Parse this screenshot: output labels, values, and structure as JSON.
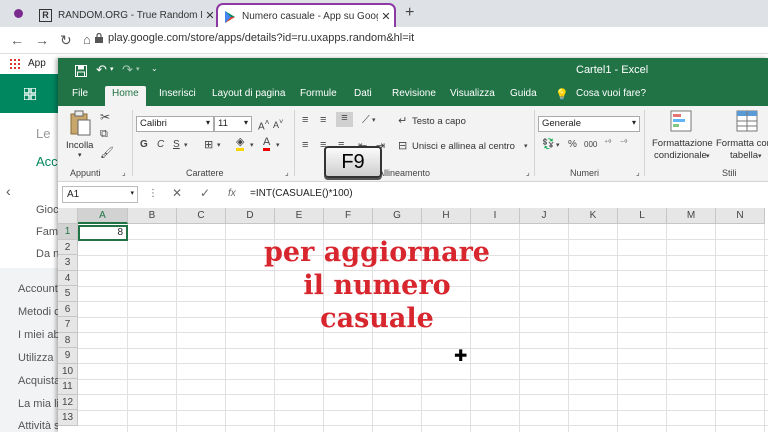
{
  "browser": {
    "tabs": [
      {
        "favicon": "R",
        "title": "RANDOM.ORG - True Random N",
        "close": "✕"
      },
      {
        "favicon": "play-icon",
        "title": "Numero casuale - App su Googl",
        "close": "✕"
      }
    ],
    "new_tab": "+",
    "url": "play.google.com/store/apps/details?id=ru.uxapps.random&hl=it",
    "bookmarks_label": "App"
  },
  "background_page": {
    "items_top": [
      "Le",
      "Acc",
      "Gioc",
      "Fam",
      "Da n"
    ],
    "items_bottom": [
      "Account",
      "Metodi c",
      "I miei ab",
      "Utilizza",
      "Acquista",
      "La mia li",
      "Attività s"
    ]
  },
  "excel": {
    "workbook_title": "Cartel1 - Excel",
    "ribbon_tabs": [
      "File",
      "Home",
      "Inserisci",
      "Layout di pagina",
      "Formule",
      "Dati",
      "Revisione",
      "Visualizza",
      "Guida",
      "Cosa vuoi fare?"
    ],
    "active_tab": "Home",
    "groups": {
      "clipboard": {
        "label": "Appunti",
        "paste": "Incolla"
      },
      "font": {
        "label": "Carattere",
        "font_name": "Calibri",
        "font_size": "11"
      },
      "alignment": {
        "label": "Allineamento",
        "wrap": "Testo a capo",
        "merge": "Unisci e allinea al centro"
      },
      "number": {
        "label": "Numeri",
        "format": "Generale"
      },
      "styles": {
        "label": "Stili",
        "cond_format_1": "Formattazione",
        "cond_format_2": "condizionale",
        "table_1": "Formatta come",
        "table_2": "tabella"
      }
    },
    "name_box": "A1",
    "formula": "=INT(CASUALE()*100)",
    "columns": [
      "A",
      "B",
      "C",
      "D",
      "E",
      "F",
      "G",
      "H",
      "I",
      "J",
      "K",
      "L",
      "M",
      "N"
    ],
    "rows": [
      "1",
      "2",
      "3",
      "4",
      "5",
      "6",
      "7",
      "8",
      "9",
      "10",
      "11",
      "12",
      "13"
    ],
    "cell_A1": "8"
  },
  "overlay": {
    "key": "F9",
    "line1": "per aggiornare",
    "line2": "il numero",
    "line3": "casuale"
  },
  "colors": {
    "excel_green": "#217346",
    "overlay_red": "#d8262e",
    "tab_accent": "#8e3aa4"
  }
}
